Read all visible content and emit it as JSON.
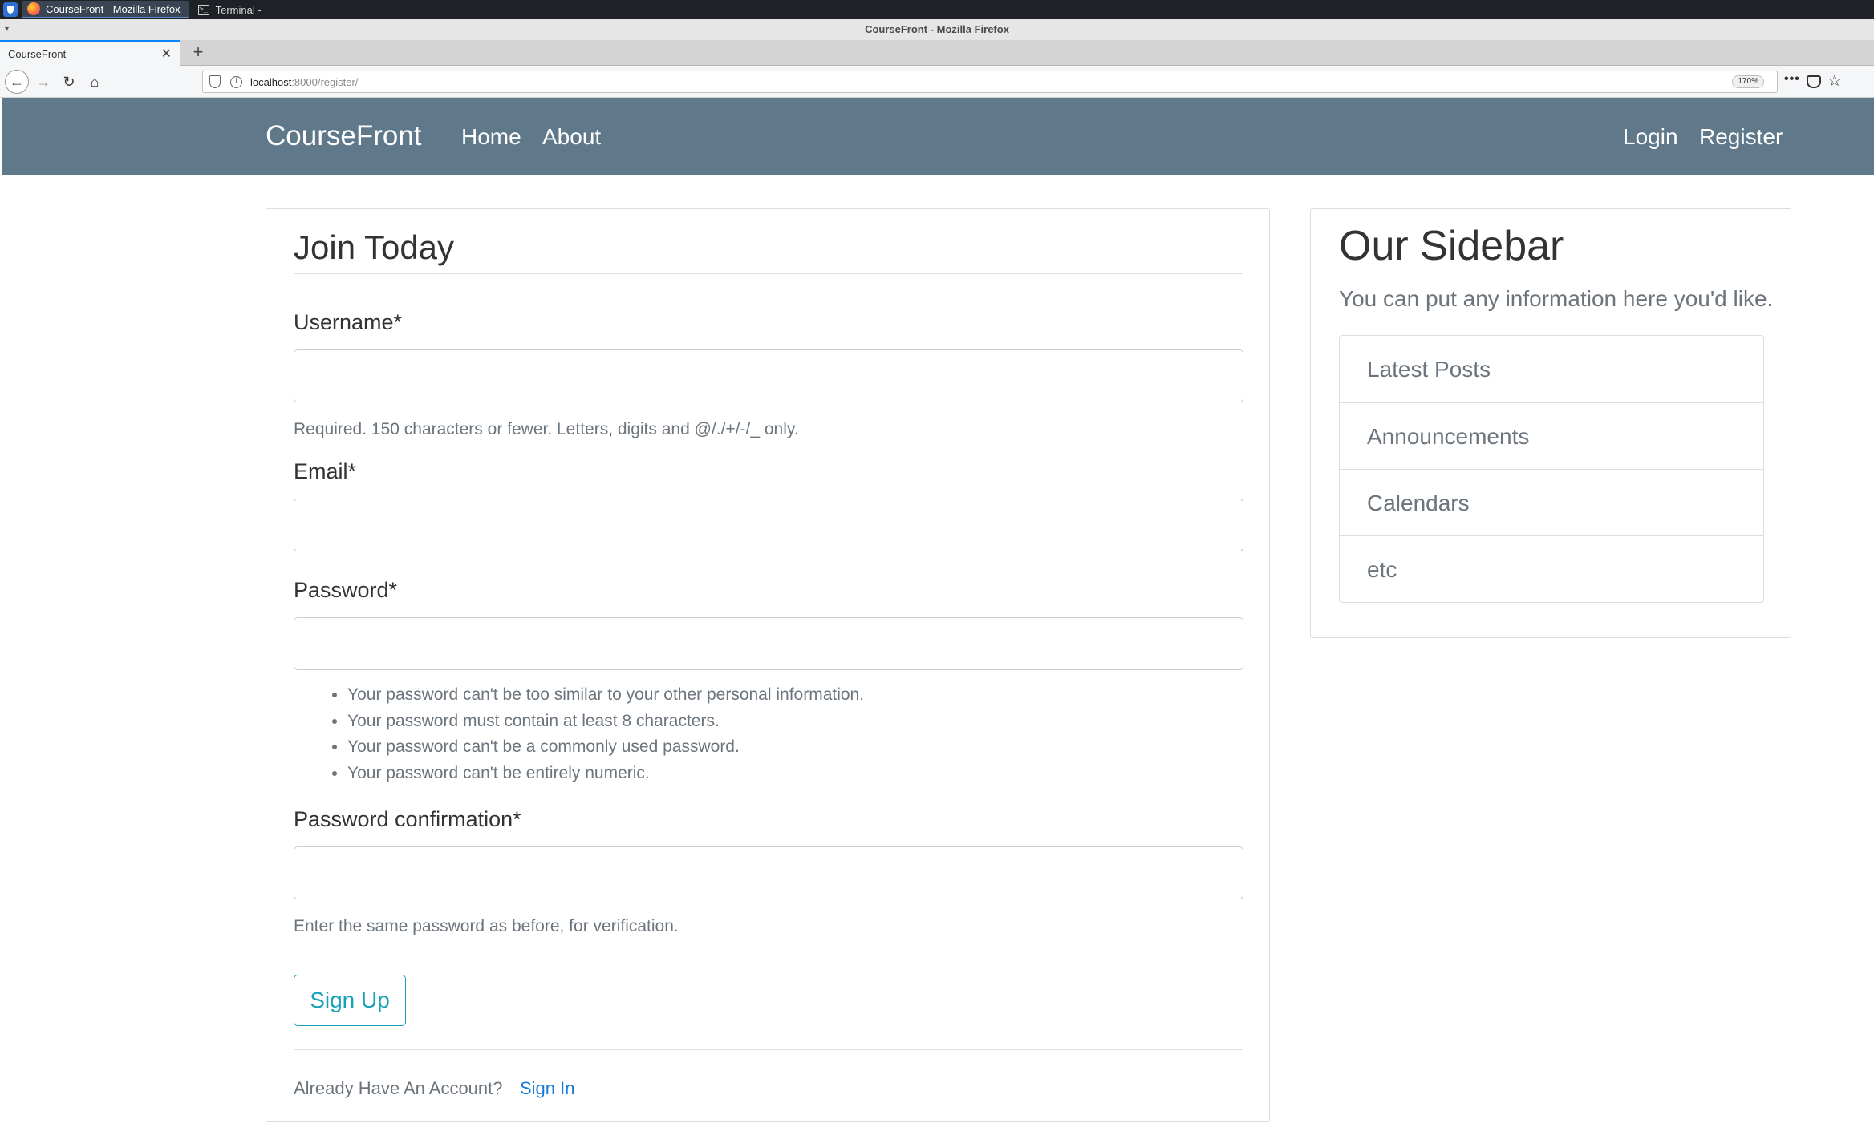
{
  "taskbar": {
    "tasks": [
      {
        "label": "CourseFront - Mozilla Firefox"
      },
      {
        "label": "Terminal -"
      }
    ]
  },
  "window": {
    "title": "CourseFront - Mozilla Firefox"
  },
  "browser": {
    "tab_title": "CourseFront",
    "url_host": "localhost",
    "url_path": ":8000/register/",
    "zoom": "170%"
  },
  "site": {
    "brand": "CourseFront",
    "nav_left": [
      "Home",
      "About"
    ],
    "nav_right": [
      "Login",
      "Register"
    ]
  },
  "form": {
    "legend": "Join Today",
    "username_label": "Username*",
    "username_value": "",
    "username_help": "Required. 150 characters or fewer. Letters, digits and @/./+/-/_ only.",
    "email_label": "Email*",
    "email_value": "",
    "password_label": "Password*",
    "password_value": "",
    "password_help": [
      "Your password can't be too similar to your other personal information.",
      "Your password must contain at least 8 characters.",
      "Your password can't be a commonly used password.",
      "Your password can't be entirely numeric."
    ],
    "password2_label": "Password confirmation*",
    "password2_value": "",
    "password2_help": "Enter the same password as before, for verification.",
    "submit_label": "Sign Up",
    "footer_text": "Already Have An Account?",
    "signin_link": "Sign In"
  },
  "sidebar": {
    "title": "Our Sidebar",
    "lead": "You can put any information here you'd like.",
    "items": [
      "Latest Posts",
      "Announcements",
      "Calendars",
      "etc"
    ]
  },
  "colors": {
    "header_bg": "#5f788a",
    "button_accent": "#17a2b8",
    "link": "#1a7bd6"
  }
}
